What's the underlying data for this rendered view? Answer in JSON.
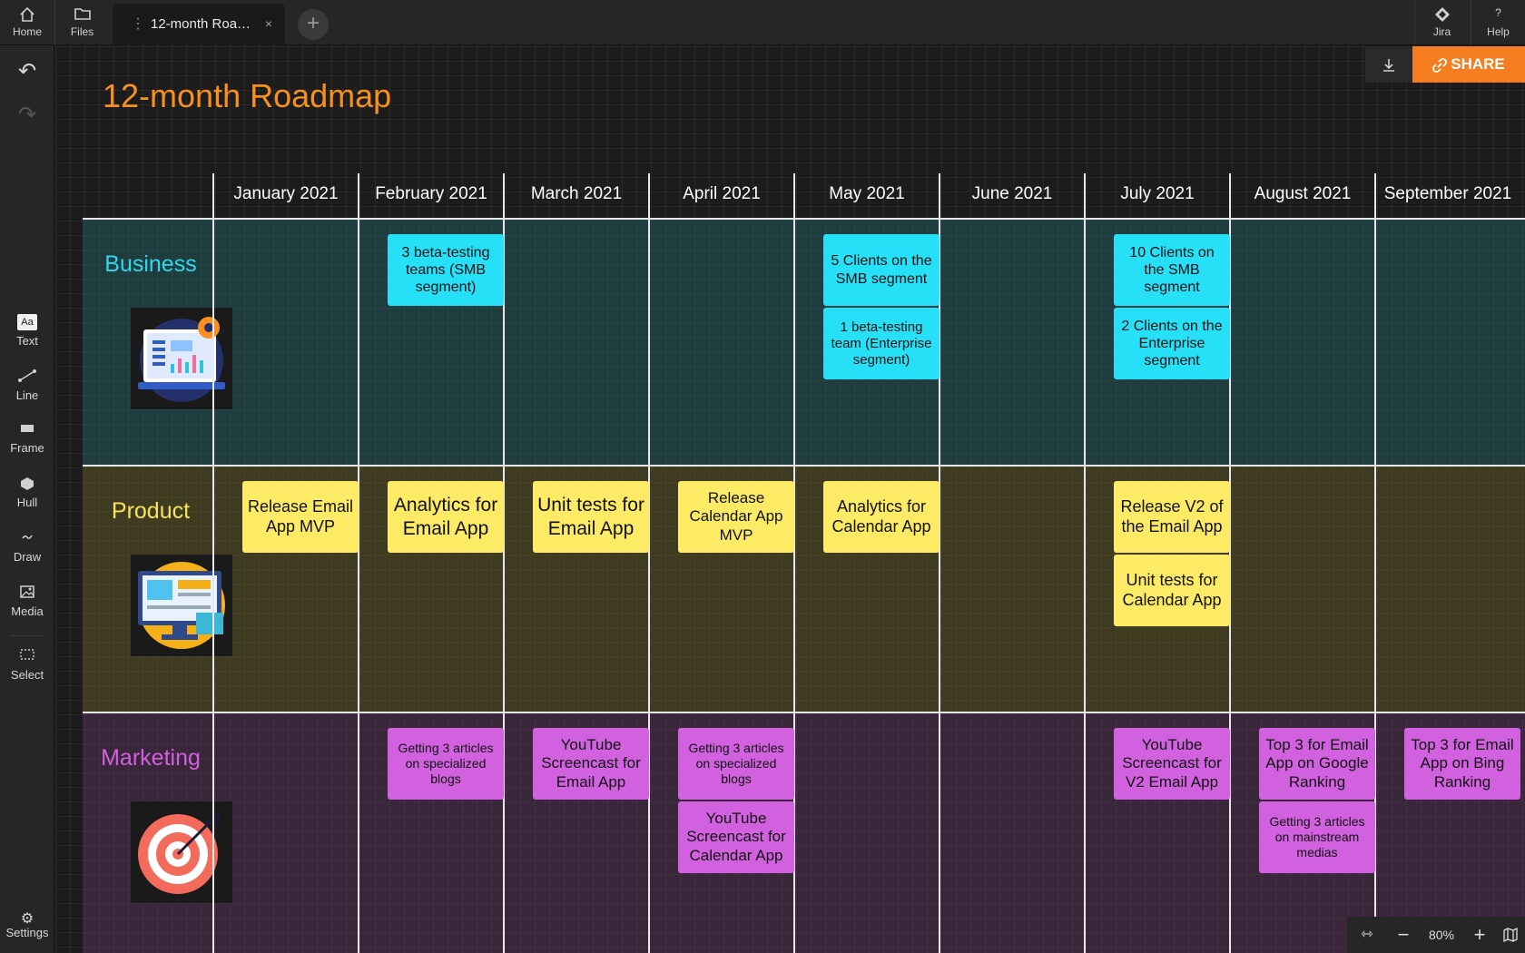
{
  "topbar": {
    "home_label": "Home",
    "files_label": "Files",
    "tab_title": "12-month Roa…",
    "tab_close": "×",
    "add_tab": "+",
    "jira_label": "Jira",
    "help_label": "Help",
    "help_icon": "?"
  },
  "sidebar": {
    "text_label": "Text",
    "text_icon": "Aa",
    "line_label": "Line",
    "frame_label": "Frame",
    "hull_label": "Hull",
    "draw_label": "Draw",
    "media_label": "Media",
    "select_label": "Select",
    "settings_label": "Settings"
  },
  "actions": {
    "share_label": "SHARE"
  },
  "zoom": {
    "level": "80%"
  },
  "board": {
    "title": "12-month Roadmap",
    "months": [
      "January 2021",
      "February 2021",
      "March 2021",
      "April 2021",
      "May 2021",
      "June 2021",
      "July 2021",
      "August 2021",
      "September 2021"
    ],
    "lanes": {
      "business": {
        "title": "Business",
        "color": "#2ed8ed"
      },
      "product": {
        "title": "Product",
        "color": "#f7e35e"
      },
      "marketing": {
        "title": "Marketing",
        "color": "#d25fe0"
      }
    },
    "cards": {
      "biz_feb": "3 beta-testing teams (SMB segment)",
      "biz_may_1": "5 Clients on the SMB segment",
      "biz_may_2": "1 beta-testing team (Enterprise segment)",
      "biz_jul_1": "10 Clients on the SMB segment",
      "biz_jul_2": "2 Clients on the Enterprise segment",
      "prod_jan": "Release Email App MVP",
      "prod_feb": "Analytics for Email App",
      "prod_mar": "Unit tests for Email App",
      "prod_apr": "Release Calendar App MVP",
      "prod_may": "Analytics for Calendar App",
      "prod_jul_1": "Release V2 of the Email App",
      "prod_jul_2": "Unit tests for Calendar App",
      "mkt_feb": "Getting 3 articles on specialized blogs",
      "mkt_mar": "YouTube Screencast for Email App",
      "mkt_apr_1": "Getting 3 articles on specialized blogs",
      "mkt_apr_2": "YouTube Screencast for Calendar App",
      "mkt_jul": "YouTube Screencast for V2 Email App",
      "mkt_aug_1": "Top 3 for Email App on Google Ranking",
      "mkt_aug_2": "Getting 3 articles on mainstream medias",
      "mkt_sep": "Top 3 for Email App on Bing Ranking"
    }
  }
}
